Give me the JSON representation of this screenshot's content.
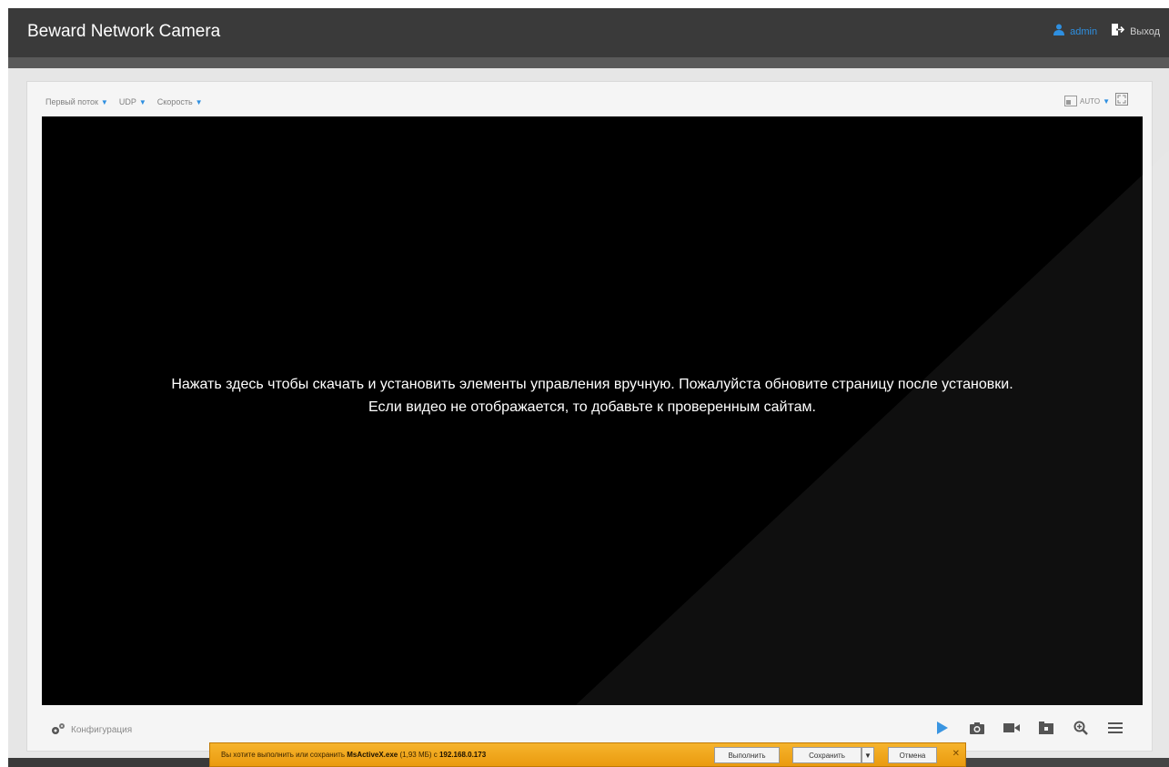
{
  "app": {
    "title": "Beward Network Camera",
    "user": "admin",
    "logout_label": "Выход",
    "accent_color": "#2e8fe0"
  },
  "stream_menu": {
    "stream": "Первый поток",
    "protocol": "UDP",
    "speed": "Скорость"
  },
  "view_controls": {
    "auto_label": "AUTO",
    "icons": [
      "aspect-icon",
      "fullscreen-icon"
    ]
  },
  "video": {
    "message_line1": "Нажать здесь чтобы скачать и установить элементы управления вручную. Пожалуйста обновите страницу после установки.",
    "message_line2": "Если видео не отображается, то добавьте к проверенным сайтам."
  },
  "bottom": {
    "config_label": "Конфигурация",
    "tools": [
      "play-icon",
      "snapshot-icon",
      "record-icon",
      "folder-icon",
      "zoom-icon",
      "menu-icon"
    ]
  },
  "download_bar": {
    "text_prefix": "Вы хотите выполнить или сохранить",
    "file_name": "MsActiveX.exe",
    "file_size": "(1,93 МБ) с",
    "host": "192.168.0.173",
    "run_label": "Выполнить",
    "save_label": "Сохранить",
    "cancel_label": "Отмена",
    "bar_color": "#f0a81e"
  }
}
